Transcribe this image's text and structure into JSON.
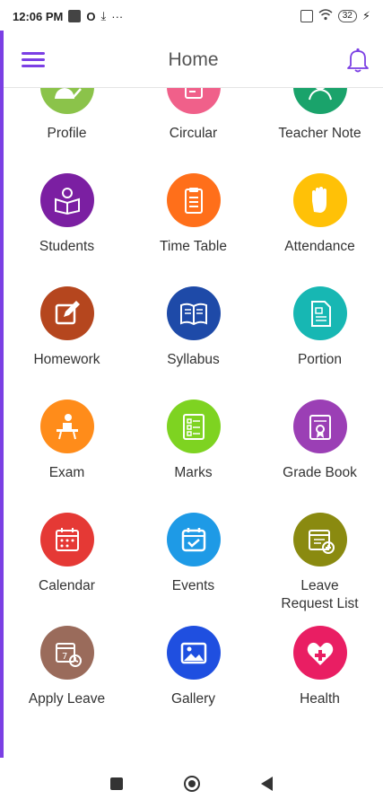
{
  "status_bar": {
    "time": "12:06 PM",
    "battery": "32",
    "left_icons": [
      "t-box-icon",
      "circle-o-icon",
      "download-icon",
      "more-dots-icon"
    ],
    "right_icons": [
      "sim-x-icon",
      "wifi-icon",
      "battery-icon",
      "charging-icon"
    ]
  },
  "header": {
    "title": "Home",
    "accent_color": "#7b3fe4",
    "menu_icon": "hamburger-icon",
    "bell_icon": "bell-icon"
  },
  "tiles": [
    {
      "label": "Profile",
      "color": "#8bc34a",
      "icon": "profile-icon"
    },
    {
      "label": "Circular",
      "color": "#f0608a",
      "icon": "circular-icon"
    },
    {
      "label": "Teacher Note",
      "color": "#1aa36b",
      "icon": "teacher-note-icon"
    },
    {
      "label": "Students",
      "color": "#7b1fa2",
      "icon": "students-icon"
    },
    {
      "label": "Time Table",
      "color": "#ff6f1a",
      "icon": "time-table-icon"
    },
    {
      "label": "Attendance",
      "color": "#ffc107",
      "icon": "attendance-hand-icon"
    },
    {
      "label": "Homework",
      "color": "#b5461e",
      "icon": "homework-icon"
    },
    {
      "label": "Syllabus",
      "color": "#1e4aa8",
      "icon": "syllabus-book-icon"
    },
    {
      "label": "Portion",
      "color": "#17b7b3",
      "icon": "portion-icon"
    },
    {
      "label": "Exam",
      "color": "#ff8c1a",
      "icon": "exam-icon"
    },
    {
      "label": "Marks",
      "color": "#7ed321",
      "icon": "marks-icon"
    },
    {
      "label": "Grade Book",
      "color": "#9b3fb5",
      "icon": "grade-book-icon"
    },
    {
      "label": "Calendar",
      "color": "#e53935",
      "icon": "calendar-icon"
    },
    {
      "label": "Events",
      "color": "#1e9ae6",
      "icon": "events-icon"
    },
    {
      "label": "Leave\nRequest List",
      "color": "#8a8a10",
      "icon": "leave-request-icon"
    },
    {
      "label": "Apply Leave",
      "color": "#9a6b5b",
      "icon": "apply-leave-icon"
    },
    {
      "label": "Gallery",
      "color": "#1f4fe0",
      "icon": "gallery-icon"
    },
    {
      "label": "Health",
      "color": "#e91e63",
      "icon": "health-icon"
    }
  ],
  "nav_bar": {
    "recent_icon": "recents-square-icon",
    "home_icon": "home-circle-icon",
    "back_icon": "back-triangle-icon"
  }
}
